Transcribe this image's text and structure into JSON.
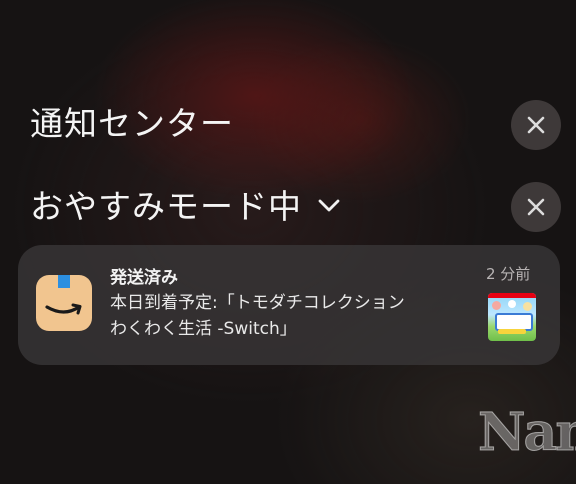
{
  "header": {
    "title": "通知センター",
    "focus_mode_label": "おやすみモード中"
  },
  "icons": {
    "close": "close-icon",
    "chevron": "chevron-down-icon",
    "app": "amazon-app-icon"
  },
  "notification": {
    "title": "発送済み",
    "body_line1": "本日到着予定:「トモダチコレクション",
    "body_line2": "わくわく生活 -Switch」",
    "time": "2 分前"
  },
  "watermark": {
    "text": "Nan"
  },
  "colors": {
    "card_bg": "#3a3738",
    "app_icon_bg": "#f1c58f",
    "app_icon_accent": "#2c8fe0"
  }
}
